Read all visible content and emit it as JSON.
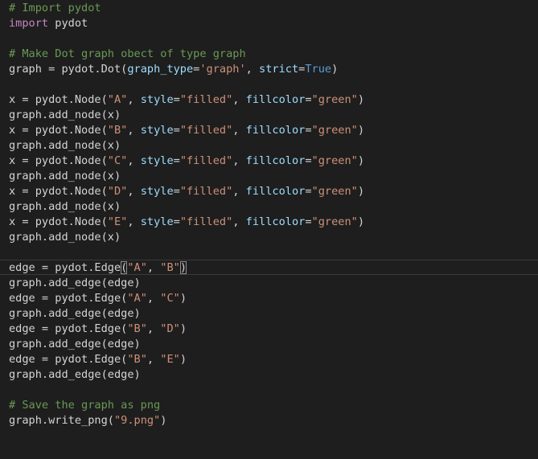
{
  "editor": {
    "lines": [
      {
        "tokens": [
          {
            "t": "# Import pydot",
            "c": "cm"
          }
        ]
      },
      {
        "tokens": [
          {
            "t": "import",
            "c": "kw"
          },
          {
            "t": " pydot",
            "c": "df"
          }
        ]
      },
      {
        "tokens": []
      },
      {
        "tokens": [
          {
            "t": "# Make Dot graph obect of type graph",
            "c": "cm"
          }
        ]
      },
      {
        "tokens": [
          {
            "t": "graph = pydot.Dot(",
            "c": "df"
          },
          {
            "t": "graph_type",
            "c": "pm"
          },
          {
            "t": "=",
            "c": "df"
          },
          {
            "t": "'graph'",
            "c": "st"
          },
          {
            "t": ", ",
            "c": "df"
          },
          {
            "t": "strict",
            "c": "pm"
          },
          {
            "t": "=",
            "c": "df"
          },
          {
            "t": "True",
            "c": "bi"
          },
          {
            "t": ")",
            "c": "df"
          }
        ]
      },
      {
        "tokens": []
      },
      {
        "tokens": [
          {
            "t": "x = pydot.Node(",
            "c": "df"
          },
          {
            "t": "\"A\"",
            "c": "st"
          },
          {
            "t": ", ",
            "c": "df"
          },
          {
            "t": "style",
            "c": "pm"
          },
          {
            "t": "=",
            "c": "df"
          },
          {
            "t": "\"filled\"",
            "c": "st"
          },
          {
            "t": ", ",
            "c": "df"
          },
          {
            "t": "fillcolor",
            "c": "pm"
          },
          {
            "t": "=",
            "c": "df"
          },
          {
            "t": "\"green\"",
            "c": "st"
          },
          {
            "t": ")",
            "c": "df"
          }
        ]
      },
      {
        "tokens": [
          {
            "t": "graph.add_node(x)",
            "c": "df"
          }
        ]
      },
      {
        "tokens": [
          {
            "t": "x = pydot.Node(",
            "c": "df"
          },
          {
            "t": "\"B\"",
            "c": "st"
          },
          {
            "t": ", ",
            "c": "df"
          },
          {
            "t": "style",
            "c": "pm"
          },
          {
            "t": "=",
            "c": "df"
          },
          {
            "t": "\"filled\"",
            "c": "st"
          },
          {
            "t": ", ",
            "c": "df"
          },
          {
            "t": "fillcolor",
            "c": "pm"
          },
          {
            "t": "=",
            "c": "df"
          },
          {
            "t": "\"green\"",
            "c": "st"
          },
          {
            "t": ")",
            "c": "df"
          }
        ]
      },
      {
        "tokens": [
          {
            "t": "graph.add_node(x)",
            "c": "df"
          }
        ]
      },
      {
        "tokens": [
          {
            "t": "x = pydot.Node(",
            "c": "df"
          },
          {
            "t": "\"C\"",
            "c": "st"
          },
          {
            "t": ", ",
            "c": "df"
          },
          {
            "t": "style",
            "c": "pm"
          },
          {
            "t": "=",
            "c": "df"
          },
          {
            "t": "\"filled\"",
            "c": "st"
          },
          {
            "t": ", ",
            "c": "df"
          },
          {
            "t": "fillcolor",
            "c": "pm"
          },
          {
            "t": "=",
            "c": "df"
          },
          {
            "t": "\"green\"",
            "c": "st"
          },
          {
            "t": ")",
            "c": "df"
          }
        ]
      },
      {
        "tokens": [
          {
            "t": "graph.add_node(x)",
            "c": "df"
          }
        ]
      },
      {
        "tokens": [
          {
            "t": "x = pydot.Node(",
            "c": "df"
          },
          {
            "t": "\"D\"",
            "c": "st"
          },
          {
            "t": ", ",
            "c": "df"
          },
          {
            "t": "style",
            "c": "pm"
          },
          {
            "t": "=",
            "c": "df"
          },
          {
            "t": "\"filled\"",
            "c": "st"
          },
          {
            "t": ", ",
            "c": "df"
          },
          {
            "t": "fillcolor",
            "c": "pm"
          },
          {
            "t": "=",
            "c": "df"
          },
          {
            "t": "\"green\"",
            "c": "st"
          },
          {
            "t": ")",
            "c": "df"
          }
        ]
      },
      {
        "tokens": [
          {
            "t": "graph.add_node(x)",
            "c": "df"
          }
        ]
      },
      {
        "tokens": [
          {
            "t": "x = pydot.Node(",
            "c": "df"
          },
          {
            "t": "\"E\"",
            "c": "st"
          },
          {
            "t": ", ",
            "c": "df"
          },
          {
            "t": "style",
            "c": "pm"
          },
          {
            "t": "=",
            "c": "df"
          },
          {
            "t": "\"filled\"",
            "c": "st"
          },
          {
            "t": ", ",
            "c": "df"
          },
          {
            "t": "fillcolor",
            "c": "pm"
          },
          {
            "t": "=",
            "c": "df"
          },
          {
            "t": "\"green\"",
            "c": "st"
          },
          {
            "t": ")",
            "c": "df"
          }
        ]
      },
      {
        "tokens": [
          {
            "t": "graph.add_node(x)",
            "c": "df"
          }
        ]
      },
      {
        "tokens": []
      },
      {
        "current": true,
        "tokens": [
          {
            "t": "edge = pydot.Edge",
            "c": "df"
          },
          {
            "t": "(",
            "c": "df",
            "b": true
          },
          {
            "t": "\"A\"",
            "c": "st"
          },
          {
            "t": ", ",
            "c": "df"
          },
          {
            "t": "\"B\"",
            "c": "st"
          },
          {
            "t": ")",
            "c": "df",
            "b": true
          }
        ]
      },
      {
        "tokens": [
          {
            "t": "graph.add_edge(edge)",
            "c": "df"
          }
        ]
      },
      {
        "tokens": [
          {
            "t": "edge = pydot.Edge(",
            "c": "df"
          },
          {
            "t": "\"A\"",
            "c": "st"
          },
          {
            "t": ", ",
            "c": "df"
          },
          {
            "t": "\"C\"",
            "c": "st"
          },
          {
            "t": ")",
            "c": "df"
          }
        ]
      },
      {
        "tokens": [
          {
            "t": "graph.add_edge(edge)",
            "c": "df"
          }
        ]
      },
      {
        "tokens": [
          {
            "t": "edge = pydot.Edge(",
            "c": "df"
          },
          {
            "t": "\"B\"",
            "c": "st"
          },
          {
            "t": ", ",
            "c": "df"
          },
          {
            "t": "\"D\"",
            "c": "st"
          },
          {
            "t": ")",
            "c": "df"
          }
        ]
      },
      {
        "tokens": [
          {
            "t": "graph.add_edge(edge)",
            "c": "df"
          }
        ]
      },
      {
        "tokens": [
          {
            "t": "edge = pydot.Edge(",
            "c": "df"
          },
          {
            "t": "\"B\"",
            "c": "st"
          },
          {
            "t": ", ",
            "c": "df"
          },
          {
            "t": "\"E\"",
            "c": "st"
          },
          {
            "t": ")",
            "c": "df"
          }
        ]
      },
      {
        "tokens": [
          {
            "t": "graph.add_edge(edge)",
            "c": "df"
          }
        ]
      },
      {
        "tokens": []
      },
      {
        "tokens": [
          {
            "t": "# Save the graph as png",
            "c": "cm"
          }
        ]
      },
      {
        "tokens": [
          {
            "t": "graph.write_png(",
            "c": "df"
          },
          {
            "t": "\"9.png\"",
            "c": "st"
          },
          {
            "t": ")",
            "c": "df"
          }
        ]
      }
    ]
  },
  "colors": {
    "background": "#1e1e1e",
    "comment": "#6a9955",
    "keyword": "#c586c0",
    "string": "#ce9178",
    "parameter": "#9cdcfe",
    "builtin_constant": "#569cd6",
    "default_text": "#d4d4d4"
  }
}
